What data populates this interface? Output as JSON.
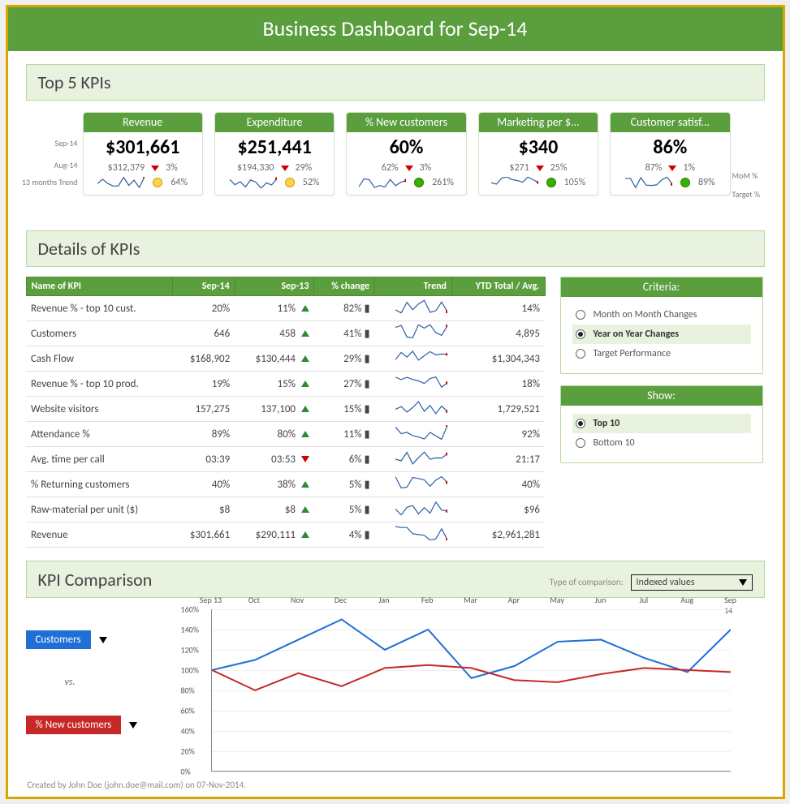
{
  "title": "Business Dashboard for Sep-14",
  "labels": {
    "top5": "Top 5 KPIs",
    "detailsHeader": "Details of KPIs",
    "compHeader": "KPI Comparison",
    "sepLabel": "Sep-14",
    "augLabel": "Aug-14",
    "trendLabel": "13 months Trend",
    "momLabel": "MoM %",
    "targetLabel": "Target %",
    "criteria": "Criteria:",
    "show": "Show:",
    "compLabel": "Type of comparison:",
    "vs": "vs."
  },
  "kpis": [
    {
      "name": "Revenue",
      "big": "$301,661",
      "prev": "$312,379",
      "mom": "3%",
      "target": "64%",
      "dot": "yellow"
    },
    {
      "name": "Expenditure",
      "big": "$251,441",
      "prev": "$194,330",
      "mom": "29%",
      "target": "52%",
      "dot": "yellow"
    },
    {
      "name": "% New customers",
      "big": "60%",
      "prev": "62%",
      "mom": "3%",
      "target": "261%",
      "dot": "green"
    },
    {
      "name": "Marketing per $...",
      "big": "$340",
      "prev": "$271",
      "mom": "25%",
      "target": "105%",
      "dot": "green"
    },
    {
      "name": "Customer satisf...",
      "big": "86%",
      "prev": "87%",
      "mom": "1%",
      "target": "89%",
      "dot": "green"
    }
  ],
  "table": {
    "cols": [
      "Name of KPI",
      "Sep-14",
      "Sep-13",
      "% change",
      "Trend",
      "YTD Total / Avg."
    ],
    "rows": [
      {
        "name": "Revenue % - top 10 cust.",
        "cur": "20%",
        "py": "11%",
        "dir": "up",
        "pct": "82%",
        "ytd": "14%"
      },
      {
        "name": "Customers",
        "cur": "646",
        "py": "458",
        "dir": "up",
        "pct": "41%",
        "ytd": "4,895"
      },
      {
        "name": "Cash Flow",
        "cur": "$168,902",
        "py": "$130,444",
        "dir": "up",
        "pct": "29%",
        "ytd": "$1,304,343"
      },
      {
        "name": "Revenue % - top 10 prod.",
        "cur": "19%",
        "py": "15%",
        "dir": "up",
        "pct": "27%",
        "ytd": "18%"
      },
      {
        "name": "Website visitors",
        "cur": "157,275",
        "py": "137,100",
        "dir": "up",
        "pct": "15%",
        "ytd": "1,729,521"
      },
      {
        "name": "Attendance %",
        "cur": "89%",
        "py": "80%",
        "dir": "up",
        "pct": "11%",
        "ytd": "92%"
      },
      {
        "name": "Avg. time per call",
        "cur": "03:39",
        "py": "03:53",
        "dir": "dn",
        "pct": "6%",
        "ytd": "21:17"
      },
      {
        "name": "% Returning customers",
        "cur": "40%",
        "py": "38%",
        "dir": "up",
        "pct": "5%",
        "ytd": "40%"
      },
      {
        "name": "Raw-material per unit ($)",
        "cur": "$8",
        "py": "$8",
        "dir": "up",
        "pct": "5%",
        "ytd": "$96"
      },
      {
        "name": "Revenue",
        "cur": "$301,661",
        "py": "$290,111",
        "dir": "up",
        "pct": "4%",
        "ytd": "$2,961,281"
      }
    ]
  },
  "criteriaOptions": [
    "Month on Month Changes",
    "Year on Year Changes",
    "Target Performance"
  ],
  "criteriaSelected": 1,
  "showOptions": [
    "Top 10",
    "Bottom 10"
  ],
  "showSelected": 0,
  "comparison": {
    "metric1": "Customers",
    "metric2": "% New customers",
    "type": "Indexed values"
  },
  "chart_data": {
    "type": "line",
    "title": "",
    "ylabel": "",
    "xlabel": "",
    "ylim": [
      0,
      160
    ],
    "yticks": [
      0,
      20,
      40,
      60,
      80,
      100,
      120,
      140,
      160
    ],
    "yticklabels": [
      "0%",
      "20%",
      "40%",
      "60%",
      "80%",
      "100%",
      "120%",
      "140%",
      "160%"
    ],
    "categories": [
      "Sep 13",
      "Oct",
      "Nov",
      "Dec",
      "Jan",
      "Feb",
      "Mar",
      "Apr",
      "May",
      "Jun",
      "Jul",
      "Aug",
      "Sep 14"
    ],
    "series": [
      {
        "name": "Customers",
        "color": "#1f6fd6",
        "values": [
          100,
          110,
          130,
          150,
          120,
          140,
          92,
          104,
          128,
          130,
          112,
          98,
          140
        ]
      },
      {
        "name": "% New customers",
        "color": "#c62828",
        "values": [
          100,
          80,
          97,
          84,
          102,
          105,
          102,
          90,
          88,
          96,
          102,
          100,
          98
        ]
      }
    ]
  },
  "footer": "Created by John Doe (john.doe@mail.com) on 07-Nov-2014."
}
